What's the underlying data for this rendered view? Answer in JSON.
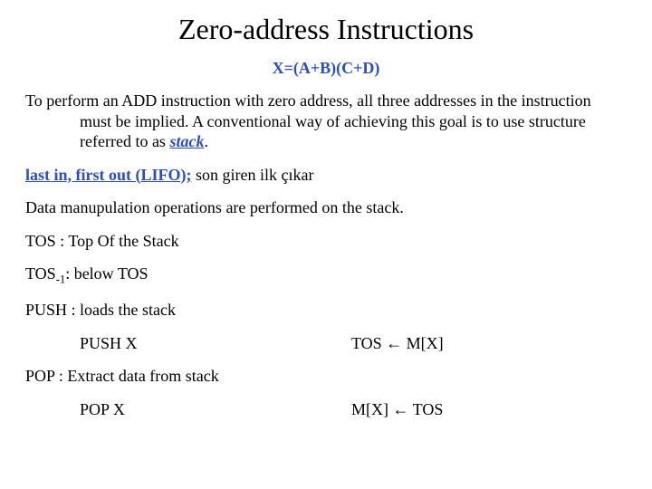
{
  "title": "Zero-address Instructions",
  "formula": "X=(A+B)(C+D)",
  "para1": "To perform an ADD instruction with zero address, all three addresses in the instruction must be implied. A conventional way of achieving this goal is to use structure referred to as ",
  "stack_word": "stack",
  "period": ".",
  "lifo_label": "last in, first out (LIFO);",
  "lifo_rest": " son giren ilk çıkar",
  "data_ops": "Data manupulation operations are performed on the stack.",
  "tos": "TOS : Top Of the Stack",
  "tos_m1_a": "TOS",
  "tos_m1_sub": "-1",
  "tos_m1_b": ": below TOS",
  "push_label": "PUSH : loads the stack",
  "push_x": "PUSH X",
  "push_rhs": "TOS ← M[X]",
  "pop_label": "POP : Extract data from stack",
  "pop_x": "POP X",
  "pop_rhs": "M[X] ← TOS"
}
